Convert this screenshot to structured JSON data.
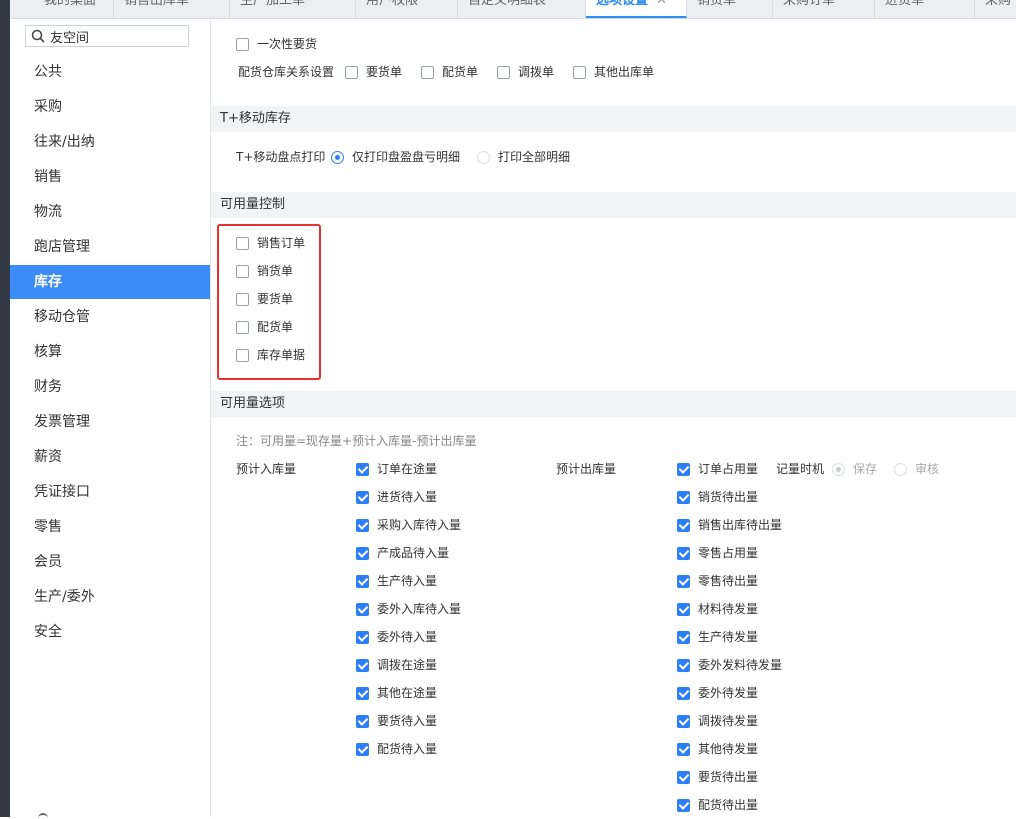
{
  "tabs": [
    {
      "label": "我的桌面",
      "modified": false,
      "active": false
    },
    {
      "label": "销售出库单",
      "modified": false,
      "active": false
    },
    {
      "label": "生产加工单",
      "modified": true,
      "active": false
    },
    {
      "label": "用户权限",
      "modified": false,
      "active": false
    },
    {
      "label": "自定义明细表",
      "modified": false,
      "active": false
    },
    {
      "label": "选项设置",
      "modified": false,
      "active": true
    },
    {
      "label": "销货单",
      "modified": false,
      "active": false
    },
    {
      "label": "采购订单",
      "modified": false,
      "active": false
    },
    {
      "label": "进货单",
      "modified": true,
      "active": false
    },
    {
      "label": "采购",
      "modified": false,
      "active": false
    }
  ],
  "tab_modified_mark": "*",
  "tab_close_glyph": "✕",
  "sidebar": {
    "search_value": "友空间",
    "items": [
      "公共",
      "采购",
      "往来/出纳",
      "销售",
      "物流",
      "跑店管理",
      "库存",
      "移动仓管",
      "核算",
      "财务",
      "发票管理",
      "薪资",
      "凭证接口",
      "零售",
      "会员",
      "生产/委外",
      "安全"
    ],
    "active_index": 6
  },
  "top_options": {
    "one_time_request": {
      "label": "一次性要货",
      "checked": false
    },
    "relation_label": "配货仓库关系设置",
    "relations": [
      {
        "label": "要货单",
        "checked": false
      },
      {
        "label": "配货单",
        "checked": false
      },
      {
        "label": "调拨单",
        "checked": false
      },
      {
        "label": "其他出库单",
        "checked": false
      }
    ]
  },
  "mobile_stock": {
    "title": "T+移动库存",
    "print_label": "T+移动盘点打印",
    "options": [
      {
        "label": "仅打印盘盈盘亏明细",
        "selected": true
      },
      {
        "label": "打印全部明细",
        "selected": false
      }
    ]
  },
  "availability_control": {
    "title": "可用量控制",
    "items": [
      {
        "label": "销售订单",
        "checked": false
      },
      {
        "label": "销货单",
        "checked": false
      },
      {
        "label": "要货单",
        "checked": false
      },
      {
        "label": "配货单",
        "checked": false
      },
      {
        "label": "库存单据",
        "checked": false
      }
    ]
  },
  "availability_options": {
    "title": "可用量选项",
    "note": "注：可用量=现存量+预计入库量-预计出库量",
    "inbound_label": "预计入库量",
    "inbound": [
      {
        "label": "订单在途量",
        "checked": true
      },
      {
        "label": "进货待入量",
        "checked": true
      },
      {
        "label": "采购入库待入量",
        "checked": true
      },
      {
        "label": "产成品待入量",
        "checked": true
      },
      {
        "label": "生产待入量",
        "checked": true
      },
      {
        "label": "委外入库待入量",
        "checked": true
      },
      {
        "label": "委外待入量",
        "checked": true
      },
      {
        "label": "调拨在途量",
        "checked": true
      },
      {
        "label": "其他在途量",
        "checked": true
      },
      {
        "label": "要货待入量",
        "checked": true
      },
      {
        "label": "配货待入量",
        "checked": true
      }
    ],
    "outbound_label": "预计出库量",
    "outbound": [
      {
        "label": "订单占用量",
        "checked": true
      },
      {
        "label": "销货待出量",
        "checked": true
      },
      {
        "label": "销售出库待出量",
        "checked": true
      },
      {
        "label": "零售占用量",
        "checked": true
      },
      {
        "label": "零售待出量",
        "checked": true
      },
      {
        "label": "材料待发量",
        "checked": true
      },
      {
        "label": "生产待发量",
        "checked": true
      },
      {
        "label": "委外发料待发量",
        "checked": true
      },
      {
        "label": "委外待发量",
        "checked": true
      },
      {
        "label": "调拨待发量",
        "checked": true
      },
      {
        "label": "其他待发量",
        "checked": true
      },
      {
        "label": "要货待出量",
        "checked": true
      },
      {
        "label": "配货待出量",
        "checked": true
      }
    ],
    "timing_label": "记量时机",
    "timing_options": [
      {
        "label": "保存",
        "selected": true
      },
      {
        "label": "审核",
        "selected": false
      }
    ]
  }
}
